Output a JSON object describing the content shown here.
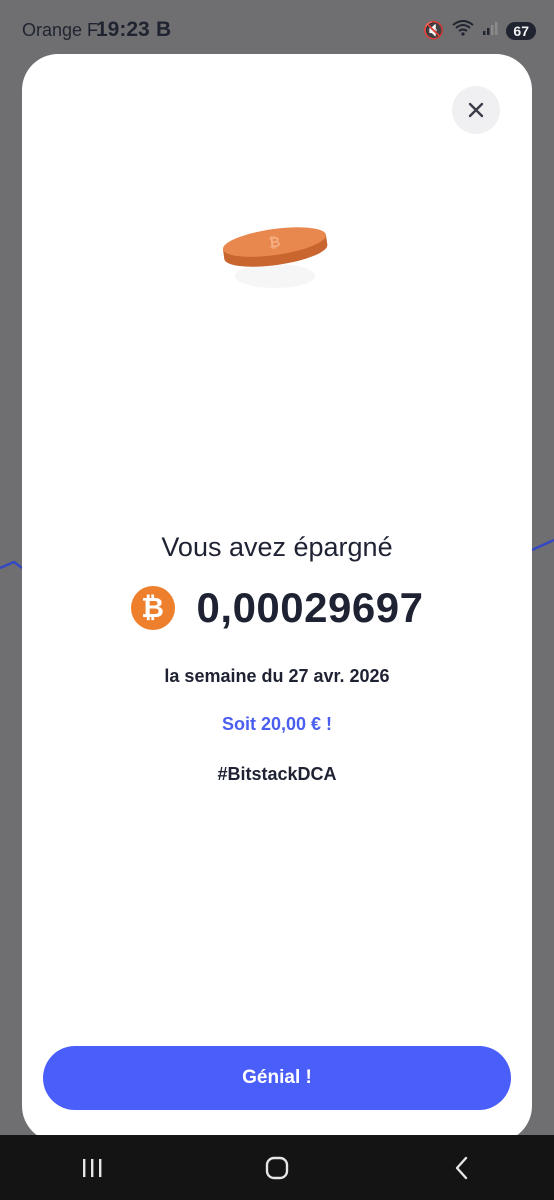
{
  "status_bar": {
    "carrier": "Orange F",
    "time": "19:23",
    "app_icon": "B",
    "battery": "67",
    "icons": [
      "mute-icon",
      "wifi-icon",
      "signal-icon",
      "battery-icon"
    ]
  },
  "modal": {
    "title": "Vous avez épargné",
    "amount": "0,00029697",
    "currency_icon": "bitcoin-icon",
    "week_label": "la semaine du 27 avr. 2026",
    "fiat_label": "Soit 20,00 € !",
    "hashtag": "#BitstackDCA",
    "confirm_label": "Génial !"
  },
  "colors": {
    "accent": "#4a5ef9",
    "bitcoin": "#ee7f2c",
    "text": "#1e2233"
  },
  "navigation": [
    "recent-apps-icon",
    "home-icon",
    "back-icon"
  ]
}
